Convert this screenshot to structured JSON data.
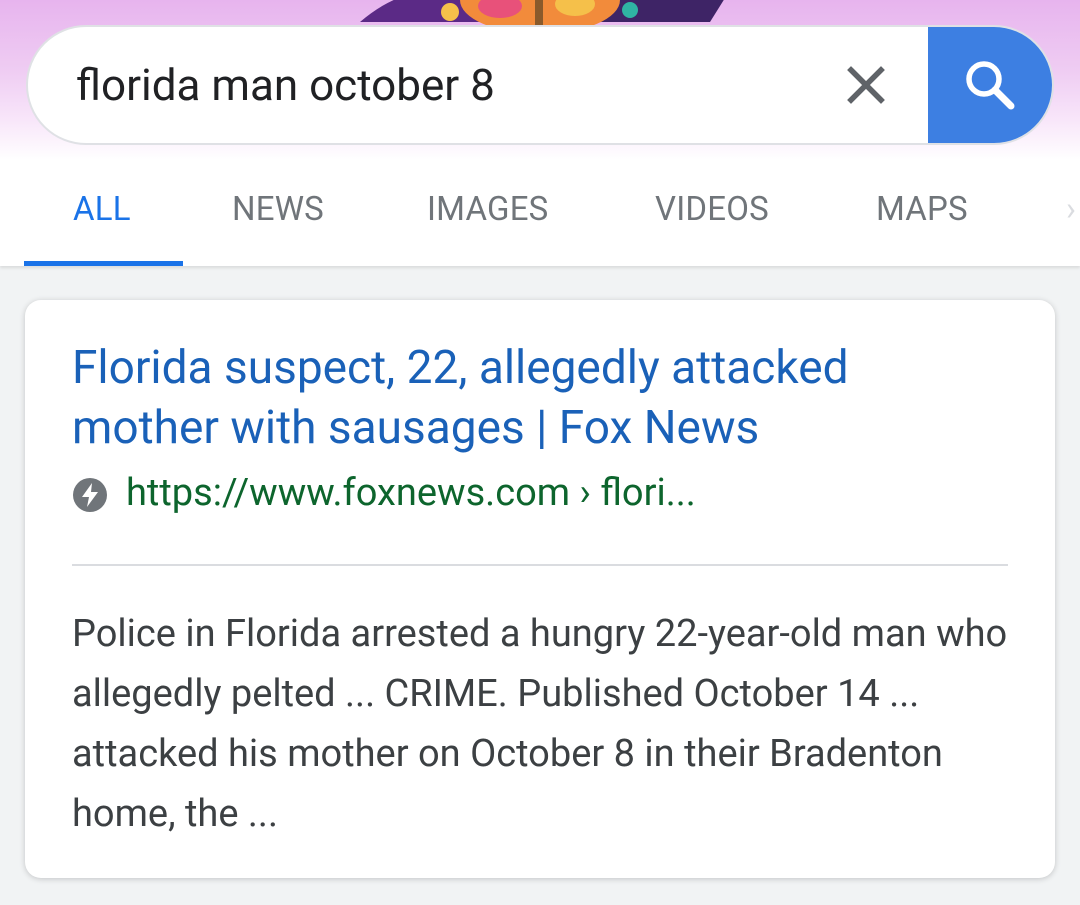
{
  "search": {
    "query": "florida man october 8"
  },
  "icons": {
    "clear": "close-icon",
    "search": "search-icon",
    "amp": "lightning-bolt-icon"
  },
  "tabs": [
    {
      "label": "ALL",
      "active": true
    },
    {
      "label": "NEWS",
      "active": false
    },
    {
      "label": "IMAGES",
      "active": false
    },
    {
      "label": "VIDEOS",
      "active": false
    },
    {
      "label": "MAPS",
      "active": false
    }
  ],
  "result": {
    "title": "Florida suspect, 22, allegedly attacked mother with sausages | Fox News",
    "url": "https://www.foxnews.com › flori...",
    "snippet": "Police in Florida arrested a hungry 22-year-old man who allegedly pelted ... CRIME. Published October 14 ... attacked his mother on October 8 in their Bradenton home, the ..."
  },
  "colors": {
    "accent_blue": "#1a73e8",
    "search_button": "#3d7fe2",
    "link_title": "#1a61b8",
    "url_green": "#0d652d",
    "doodle_pink": "#e7b4ee"
  }
}
